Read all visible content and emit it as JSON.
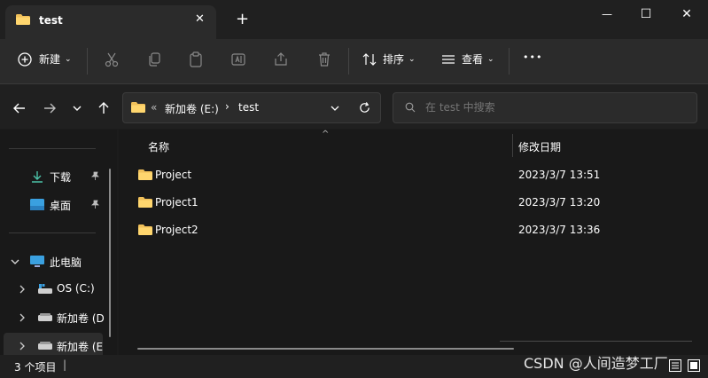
{
  "window": {
    "tab_title": "test",
    "new_tab_symbol": "+",
    "close_tab_symbol": "✕",
    "minimize_symbol": "—",
    "maximize_symbol": "☐",
    "close_symbol": "✕"
  },
  "toolbar": {
    "new_label": "新建",
    "sort_label": "排序",
    "view_label": "查看",
    "more_symbol": "•••"
  },
  "address": {
    "prefix": "«",
    "crumbs": [
      "新加卷 (E:)",
      "test"
    ],
    "separator": "›"
  },
  "search": {
    "placeholder": "在 test 中搜索"
  },
  "sidebar": {
    "quick_access": [
      {
        "label": "下载",
        "icon": "download-icon"
      },
      {
        "label": "桌面",
        "icon": "desktop-icon"
      }
    ],
    "this_pc": "此电脑",
    "drives": [
      {
        "label": "OS (C:)"
      },
      {
        "label": "新加卷 (D"
      },
      {
        "label": "新加卷 (E"
      }
    ]
  },
  "columns": {
    "name": "名称",
    "date": "修改日期"
  },
  "files": [
    {
      "name": "Project",
      "date": "2023/3/7 13:51"
    },
    {
      "name": "Project1",
      "date": "2023/3/7 13:20"
    },
    {
      "name": "Project2",
      "date": "2023/3/7 13:36"
    }
  ],
  "status": {
    "count": "3 个项目",
    "cursor": "|"
  },
  "watermark": "CSDN @人间造梦工厂"
}
